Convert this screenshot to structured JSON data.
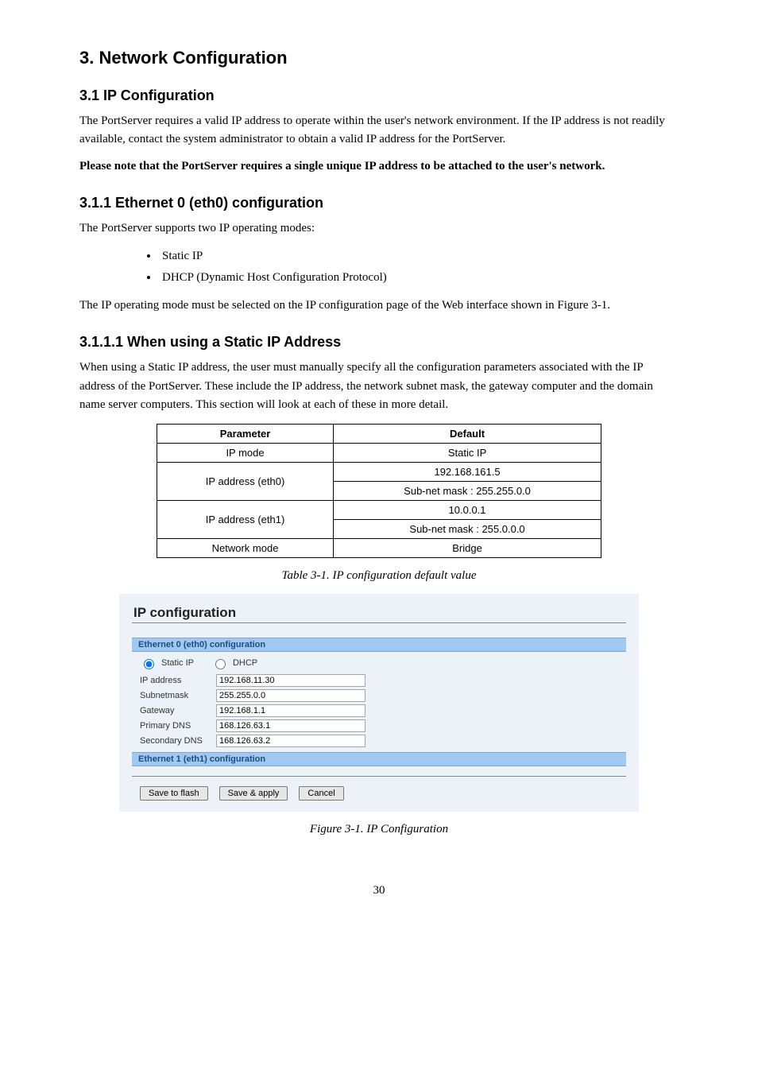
{
  "heading": "3. Network Configuration",
  "sub1": "3.1 IP Configuration",
  "intro_para": "The PortServer requires a valid IP address to operate within the user's network environment. If the IP address is not readily available, contact the system administrator to obtain a valid IP address for the PortServer.",
  "note_label": "Please note that the PortServer requires a single unique IP address to be attached to the user's network.",
  "sub2": "3.1.1 Ethernet 0 (eth0) configuration",
  "modes_intro": "The PortServer supports two IP operating modes:",
  "bullet1": "Static IP",
  "bullet2": "DHCP (Dynamic Host Configuration Protocol)",
  "modes_para": "The IP operating mode must be selected on the IP configuration page of the Web interface shown in Figure 3-1.",
  "sub3": "3.1.1.1 When using a Static IP Address",
  "static_para": "When using a Static IP address, the user must manually specify all the configuration parameters associated with the IP address of the PortServer. These include the IP address, the network subnet mask, the gateway computer and the domain name server computers. This section will look at each of these in more detail.",
  "table": {
    "hdr1": "Parameter",
    "hdr2": "Default",
    "r1c1": "IP mode",
    "r1c2": "Static IP",
    "r2c1": "IP address (eth0)",
    "r2c2": "192.168.161.5",
    "r2c3": "Sub-net mask : 255.255.0.0",
    "r3c1": "IP address (eth1)",
    "r3c2": "10.0.0.1",
    "r3c3": "Sub-net mask : 255.0.0.0",
    "r4c1": "Network mode",
    "r4c2": "Bridge"
  },
  "tablecap": "Table 3-1. IP configuration default value",
  "figcap": "Figure 3-1. IP Configuration",
  "panel": {
    "title": "IP configuration",
    "band0": "Ethernet 0 (eth0) configuration",
    "radio_static": "Static IP",
    "radio_dhcp": "DHCP",
    "lbl_ip": "IP address",
    "lbl_mask": "Subnetmask",
    "lbl_gw": "Gateway",
    "lbl_dns1": "Primary DNS",
    "lbl_dns2": "Secondary DNS",
    "val_ip": "192.168.11.30",
    "val_mask": "255.255.0.0",
    "val_gw": "192.168.1.1",
    "val_dns1": "168.126.63.1",
    "val_dns2": "168.126.63.2",
    "band1": "Ethernet 1 (eth1) configuration",
    "btn_save_flash": "Save to flash",
    "btn_save_apply": "Save & apply",
    "btn_cancel": "Cancel"
  },
  "page_no": "30"
}
